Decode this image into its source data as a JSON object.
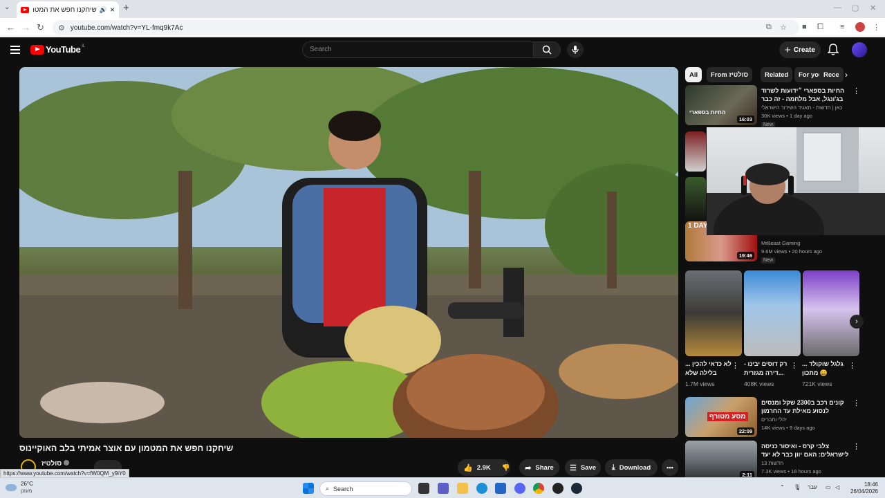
{
  "browser": {
    "tab_title": "שיחקנו חפש את המטמון עי",
    "url": "youtube.com/watch?v=YL-fmq9k7Ac",
    "status_url": "https://www.youtube.com/watch?v=fW0QM_y9iY0"
  },
  "header": {
    "logo_text": "YouTube",
    "logo_country": "IL",
    "search_placeholder": "Search",
    "create_label": "Create"
  },
  "video": {
    "title": "שיחקנו חפש את המטמון עם אוצר אמיתי בלב האוקיינוס",
    "channel": "סולטיז",
    "likes": "2.9K",
    "share_label": "Share",
    "save_label": "Save",
    "download_label": "Download"
  },
  "chips": [
    "All",
    "From סולטיז",
    "Related",
    "For you",
    "Rece"
  ],
  "recommendations": [
    {
      "title": "החיות בספארי ״ידועות לשרוד בג'ונגל, אבל מלחמה - זה כבר סיפור אחר״",
      "channel": "כאן | חדשות - תאגיד השידור הישראלי",
      "meta": "30K views • 1 day ago",
      "badge": "New",
      "duration": "16:03",
      "thumb_text": "החיות בספארי"
    },
    {
      "title": "",
      "channel": "MrBeast Gaming",
      "meta": "9.6M views • 20 hours ago",
      "badge": "New",
      "duration": "19:46",
      "thumb_text": "1 DAY"
    },
    {
      "title": "קונים רכב ב2300 שקל ומנסים לנסוע מאילת עד החרמון",
      "channel": "יהלי וחברים",
      "meta": "14K views • 9 days ago",
      "badge": "",
      "duration": "22:09",
      "thumb_text": "מסע מטורף"
    },
    {
      "title": "צלבי קרס - ואיסור כניסה לישראלים: האם יוון כבר לא יעד בטוח?",
      "channel": "13 חדשות",
      "meta": "7.3K views • 18 hours ago",
      "badge": "",
      "duration": "2:11",
      "thumb_text": ""
    }
  ],
  "shorts": [
    {
      "title": "לא כדאי להכין ... בלילה שלא",
      "views": "1.7M views"
    },
    {
      "title": "רק דוסים יבינו - ...דירה מגזרית",
      "views": "408K views"
    },
    {
      "title": "גלגל שוקולד ... 😄 מתכון",
      "views": "721K views"
    }
  ],
  "taskbar": {
    "temperature": "26°C",
    "condition": "מעונן",
    "search_label": "Search",
    "lang": "עבר",
    "time": "18:46",
    "date": "26/04/2026"
  },
  "colors": {
    "youtube_red": "#ff0000",
    "page_bg": "#0f0f0f",
    "chip_bg": "#272727"
  }
}
